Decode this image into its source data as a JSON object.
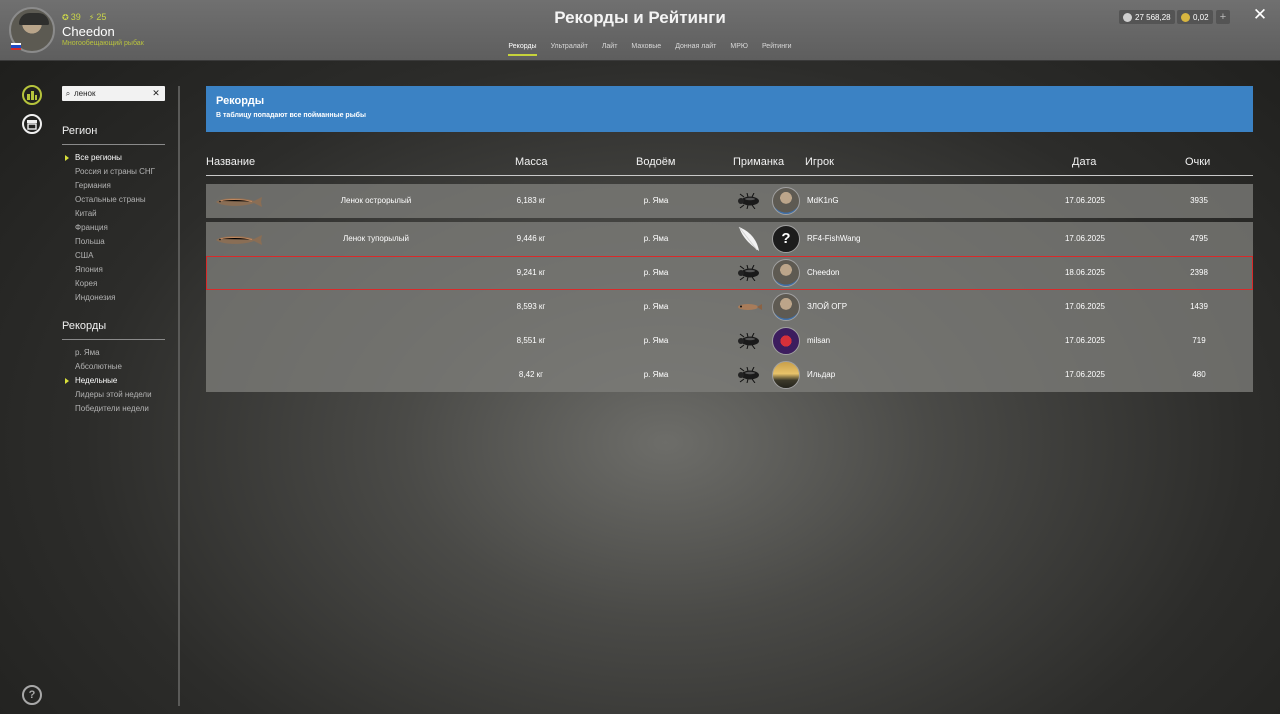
{
  "header": {
    "title": "Рекорды и Рейтинги",
    "user": {
      "name": "Cheedon",
      "level": "39",
      "stat2": "25",
      "status": "Многообещающий рыбак"
    },
    "tabs": [
      {
        "label": "Рекорды",
        "active": true
      },
      {
        "label": "Ультралайт",
        "active": false
      },
      {
        "label": "Лайт",
        "active": false
      },
      {
        "label": "Маховые",
        "active": false
      },
      {
        "label": "Донная лайт",
        "active": false
      },
      {
        "label": "МРЮ",
        "active": false
      },
      {
        "label": "Рейтинги",
        "active": false
      }
    ],
    "silver": "27 568,28",
    "gold": "0,02",
    "plus_label": "+",
    "close_label": "✕"
  },
  "sidebar": {
    "search_value": "ленок",
    "region_heading": "Регион",
    "regions": [
      {
        "label": "Все регионы",
        "selected": true
      },
      {
        "label": "Россия и страны СНГ",
        "selected": false
      },
      {
        "label": "Германия",
        "selected": false
      },
      {
        "label": "Остальные страны",
        "selected": false
      },
      {
        "label": "Китай",
        "selected": false
      },
      {
        "label": "Франция",
        "selected": false
      },
      {
        "label": "Польша",
        "selected": false
      },
      {
        "label": "США",
        "selected": false
      },
      {
        "label": "Япония",
        "selected": false
      },
      {
        "label": "Корея",
        "selected": false
      },
      {
        "label": "Индонезия",
        "selected": false
      }
    ],
    "records_heading": "Рекорды",
    "records": [
      {
        "label": "р. Яма",
        "selected": false
      },
      {
        "label": "Абсолютные",
        "selected": false
      },
      {
        "label": "Недельные",
        "selected": true
      },
      {
        "label": "Лидеры этой недели",
        "selected": false
      },
      {
        "label": "Победители недели",
        "selected": false
      }
    ],
    "help_label": "?"
  },
  "banner": {
    "title": "Рекорды",
    "subtitle": "В таблицу попадают все пойманные рыбы"
  },
  "table": {
    "columns": [
      "Название",
      "Масса",
      "Водоём",
      "Приманка",
      "Игрок",
      "Дата",
      "Очки"
    ],
    "rows": [
      {
        "fish": "Ленок острорылый",
        "mass": "6,183 кг",
        "water": "р. Яма",
        "lure": "beetle",
        "player": "MdK1nG",
        "avatar": "fisher",
        "date": "17.06.2025",
        "points": "3935"
      },
      {
        "fish": "Ленок тупорылый",
        "mass": "9,446 кг",
        "water": "р. Яма",
        "lure": "feather",
        "player": "RF4-FishWang",
        "avatar": "unknown",
        "date": "17.06.2025",
        "points": "4795"
      },
      {
        "fish": "",
        "mass": "9,241 кг",
        "water": "р. Яма",
        "lure": "beetle",
        "player": "Cheedon",
        "avatar": "fisher",
        "date": "18.06.2025",
        "points": "2398"
      },
      {
        "fish": "",
        "mass": "8,593 кг",
        "water": "р. Яма",
        "lure": "minnow",
        "player": "ЗЛОЙ ОГР",
        "avatar": "fisher",
        "date": "17.06.2025",
        "points": "1439"
      },
      {
        "fish": "",
        "mass": "8,551 кг",
        "water": "р. Яма",
        "lure": "beetle",
        "player": "milsan",
        "avatar": "red",
        "date": "17.06.2025",
        "points": "719"
      },
      {
        "fish": "",
        "mass": "8,42 кг",
        "water": "р. Яма",
        "lure": "beetle",
        "player": "Ильдар",
        "avatar": "sunset",
        "date": "17.06.2025",
        "points": "480"
      }
    ]
  },
  "colors": {
    "accent": "#c6d33b",
    "banner": "#3b82c4",
    "highlight": "#d92a2a"
  }
}
